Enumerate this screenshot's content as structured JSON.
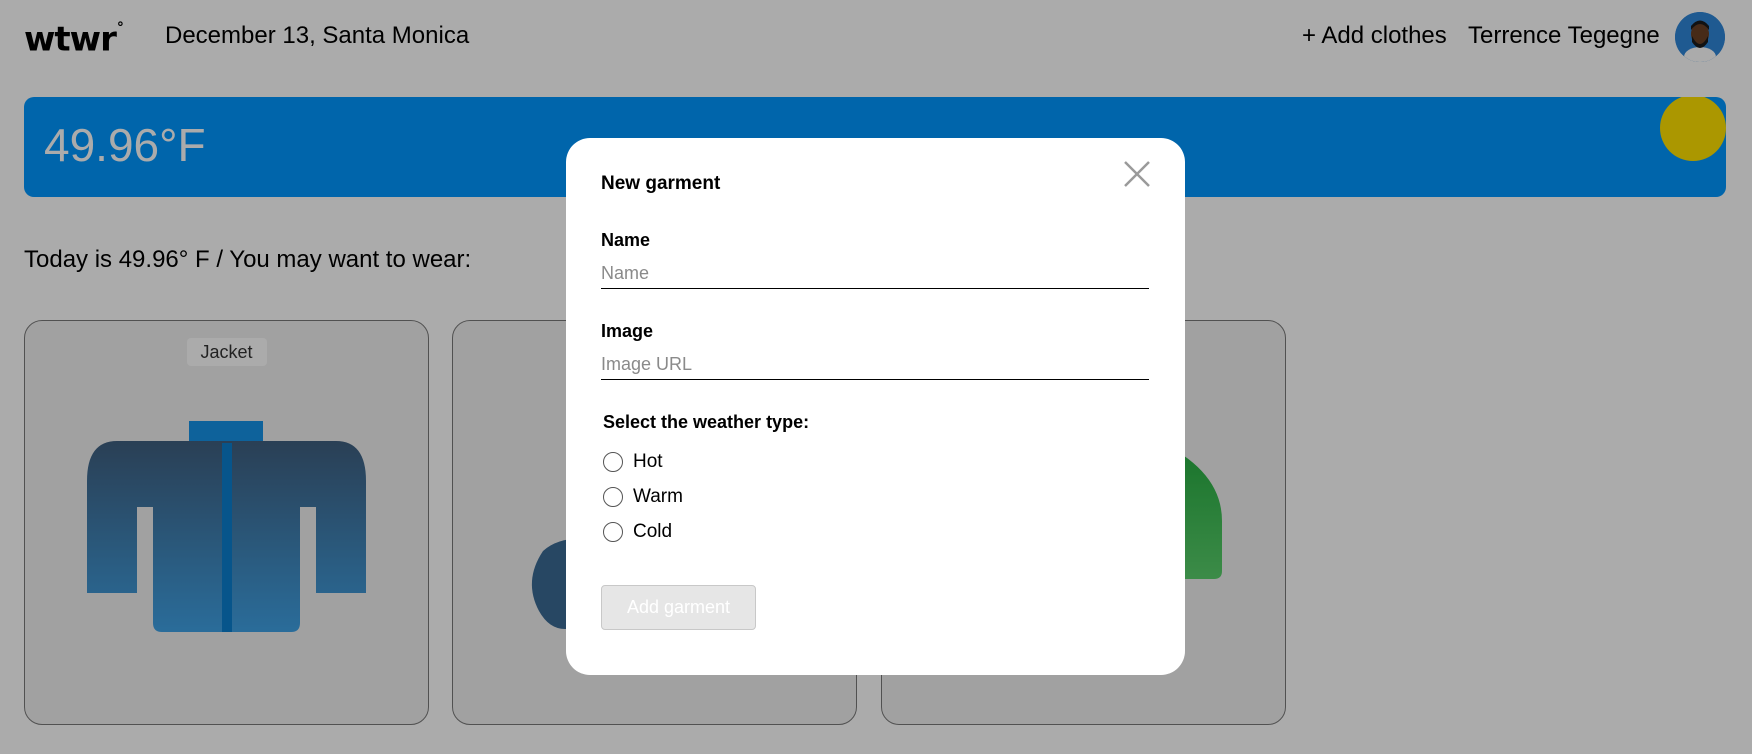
{
  "header": {
    "logo": "wtwr",
    "logo_mark": "°",
    "date_location": "December 13, Santa Monica",
    "add_clothes_label": "+ Add clothes",
    "user_name": "Terrence Tegegne"
  },
  "weather": {
    "temperature": "49.96°F",
    "recommendation": "Today is 49.96° F / You may want to wear:"
  },
  "cards": [
    {
      "label": "Jacket"
    }
  ],
  "modal": {
    "title": "New garment",
    "name_label": "Name",
    "name_placeholder": "Name",
    "name_value": "",
    "image_label": "Image",
    "image_placeholder": "Image URL",
    "image_value": "",
    "weather_title": "Select the weather type:",
    "options": [
      "Hot",
      "Warm",
      "Cold"
    ],
    "submit_label": "Add garment"
  },
  "colors": {
    "banner": "#0097ff",
    "sun": "#ffe100",
    "overlay": "rgba(0,0,0,0.33)"
  }
}
